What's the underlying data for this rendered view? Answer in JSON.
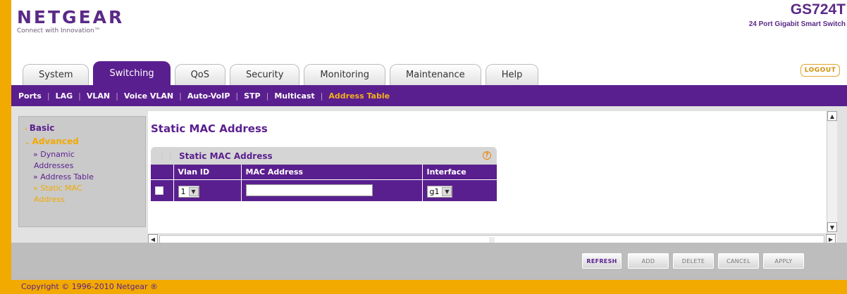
{
  "brand": {
    "name": "NETGEAR",
    "tagline": "Connect with Innovation™"
  },
  "product": {
    "model": "GS724T",
    "description": "24 Port Gigabit Smart Switch"
  },
  "tabs": [
    {
      "label": "System",
      "active": false
    },
    {
      "label": "Switching",
      "active": true
    },
    {
      "label": "QoS",
      "active": false
    },
    {
      "label": "Security",
      "active": false
    },
    {
      "label": "Monitoring",
      "active": false
    },
    {
      "label": "Maintenance",
      "active": false
    },
    {
      "label": "Help",
      "active": false
    }
  ],
  "logout_label": "LOGOUT",
  "subnav": [
    {
      "label": "Ports",
      "active": false
    },
    {
      "label": "LAG",
      "active": false
    },
    {
      "label": "VLAN",
      "active": false
    },
    {
      "label": "Voice VLAN",
      "active": false
    },
    {
      "label": "Auto-VoIP",
      "active": false
    },
    {
      "label": "STP",
      "active": false
    },
    {
      "label": "Multicast",
      "active": false
    },
    {
      "label": "Address Table",
      "active": true
    }
  ],
  "sidebar": {
    "basic": "Basic",
    "advanced": "Advanced",
    "items": [
      {
        "line1": "» Dynamic",
        "line2": "Addresses"
      },
      {
        "line1": "» Address Table"
      },
      {
        "line1": "» Static MAC",
        "line2": "Address"
      }
    ]
  },
  "page": {
    "title": "Static MAC Address"
  },
  "table": {
    "title": "Static MAC Address",
    "headers": [
      "",
      "Vlan ID",
      "MAC Address",
      "Interface"
    ],
    "row": {
      "vlan_id": "1",
      "mac_address": "",
      "interface": "g1"
    }
  },
  "buttons": {
    "refresh": "REFRESH",
    "add": "ADD",
    "delete": "DELETE",
    "cancel": "CANCEL",
    "apply": "APPLY"
  },
  "copyright": "Copyright © 1996-2010 Netgear ®",
  "colors": {
    "brand_purple": "#5a1f8e",
    "accent_orange": "#f2a900"
  }
}
